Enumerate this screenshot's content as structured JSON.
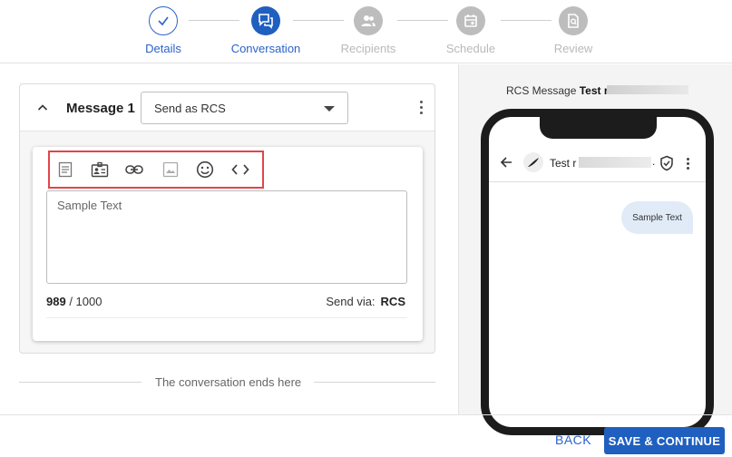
{
  "stepper": {
    "steps": [
      {
        "label": "Details",
        "state": "done"
      },
      {
        "label": "Conversation",
        "state": "active"
      },
      {
        "label": "Recipients",
        "state": "pending"
      },
      {
        "label": "Schedule",
        "state": "pending"
      },
      {
        "label": "Review",
        "state": "pending"
      }
    ]
  },
  "message": {
    "title": "Message 1",
    "send_mode": "Send as RCS",
    "toolbar_icons": [
      "template-icon",
      "contact-card-icon",
      "link-icon",
      "image-icon",
      "emoji-icon",
      "code-icon"
    ],
    "body_text": "Sample Text",
    "count_used": "989",
    "count_sep": " / 1000",
    "send_via_label": "Send via:",
    "send_via_value": "RCS"
  },
  "conversation_end": "The conversation ends here",
  "preview": {
    "title_prefix": "RCS Message",
    "title_bold": "Test r",
    "contact_name": "Test r",
    "contact_suffix": ".",
    "bubble_text": "Sample Text"
  },
  "footer": {
    "back_label": "BACK",
    "save_label": "SAVE & CONTINUE"
  },
  "colors": {
    "primary": "#1f5fbf",
    "highlight_border": "#e0454b",
    "pending": "#bdbdbd",
    "bubble": "#e1ebf8"
  }
}
